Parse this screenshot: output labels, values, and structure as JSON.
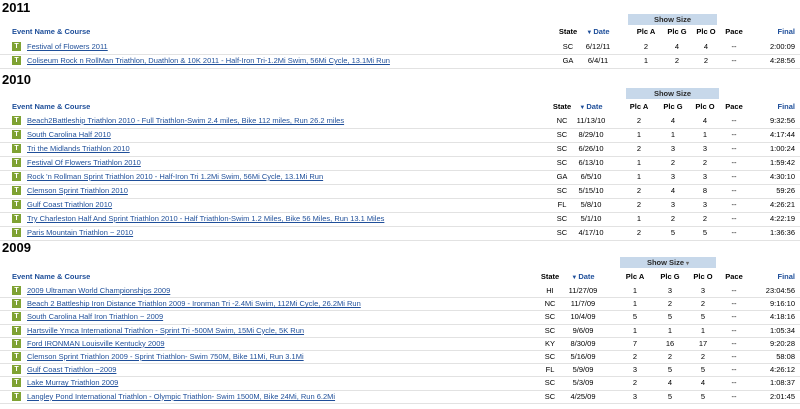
{
  "columns": {
    "event": "Event Name & Course",
    "state": "State",
    "date": "Date",
    "date_sort": "▼",
    "plc_a": "Plc A",
    "plc_g": "Plc G",
    "plc_o": "Plc O",
    "pace": "Pace",
    "final": "Final",
    "show_size": "Show Size",
    "show_size_caret": "▾"
  },
  "type_icon": "T",
  "sections": [
    {
      "year": "2011",
      "rows": [
        {
          "event": "Festival of Flowers 2011",
          "state": "SC",
          "date": "6/12/11",
          "a": "2",
          "g": "4",
          "o": "4",
          "pace": "--",
          "final": "2:00:09"
        },
        {
          "event": "Coliseum Rock n RollMan Triathlon, Duathlon & 10K 2011 - Half-Iron Tri-1.2Mi Swim, 56Mi Cycle, 13.1Mi Run",
          "state": "GA",
          "date": "6/4/11",
          "a": "1",
          "g": "2",
          "o": "2",
          "pace": "--",
          "final": "4:28:56"
        }
      ]
    },
    {
      "year": "2010",
      "rows": [
        {
          "event": "Beach2Battleship Triathlon 2010 - Full Triathlon-Swim 2.4 miles, Bike 112 miles, Run 26.2 miles",
          "state": "NC",
          "date": "11/13/10",
          "a": "2",
          "g": "4",
          "o": "4",
          "pace": "--",
          "final": "9:32:56"
        },
        {
          "event": "South Carolina Half 2010",
          "state": "SC",
          "date": "8/29/10",
          "a": "1",
          "g": "1",
          "o": "1",
          "pace": "--",
          "final": "4:17:44"
        },
        {
          "event": "Tri the Midlands Triathlon 2010",
          "state": "SC",
          "date": "6/26/10",
          "a": "2",
          "g": "3",
          "o": "3",
          "pace": "--",
          "final": "1:00:24"
        },
        {
          "event": "Festival Of Flowers Triathlon 2010",
          "state": "SC",
          "date": "6/13/10",
          "a": "1",
          "g": "2",
          "o": "2",
          "pace": "--",
          "final": "1:59:42"
        },
        {
          "event": "Rock 'n Rollman Sprint Triathlon 2010 - Half-Iron Tri 1.2Mi Swim, 56Mi Cycle, 13.1Mi Run",
          "state": "GA",
          "date": "6/5/10",
          "a": "1",
          "g": "3",
          "o": "3",
          "pace": "--",
          "final": "4:30:10"
        },
        {
          "event": "Clemson Sprint Triathlon 2010",
          "state": "SC",
          "date": "5/15/10",
          "a": "2",
          "g": "4",
          "o": "8",
          "pace": "--",
          "final": "59:26"
        },
        {
          "event": "Gulf Coast Triathlon 2010",
          "state": "FL",
          "date": "5/8/10",
          "a": "2",
          "g": "3",
          "o": "3",
          "pace": "--",
          "final": "4:26:21"
        },
        {
          "event": "Try Charleston Half And Sprint Triathlon 2010 - Half Triathlon-Swim 1.2 Miles, Bike 56 Miles, Run 13.1 Miles",
          "state": "SC",
          "date": "5/1/10",
          "a": "1",
          "g": "2",
          "o": "2",
          "pace": "--",
          "final": "4:22:19"
        },
        {
          "event": "Paris Mountain Triathlon ~ 2010",
          "state": "SC",
          "date": "4/17/10",
          "a": "2",
          "g": "5",
          "o": "5",
          "pace": "--",
          "final": "1:36:36"
        }
      ]
    },
    {
      "year": "2009",
      "rows": [
        {
          "event": "2009 Ultraman World Championships 2009",
          "state": "HI",
          "date": "11/27/09",
          "a": "1",
          "g": "3",
          "o": "3",
          "pace": "--",
          "final": "23:04:56"
        },
        {
          "event": "Beach 2 Battleship Iron Distance Triathlon 2009 - Ironman Tri -2.4Mi Swim, 112Mi Cycle, 26.2Mi Run",
          "state": "NC",
          "date": "11/7/09",
          "a": "1",
          "g": "2",
          "o": "2",
          "pace": "--",
          "final": "9:16:10"
        },
        {
          "event": "South Carolina Half Iron Triathlon ~ 2009",
          "state": "SC",
          "date": "10/4/09",
          "a": "5",
          "g": "5",
          "o": "5",
          "pace": "--",
          "final": "4:18:16"
        },
        {
          "event": "Hartsville Ymca International Triathlon - Sprint Tri -500M Swim, 15Mi Cycle, 5K Run",
          "state": "SC",
          "date": "9/6/09",
          "a": "1",
          "g": "1",
          "o": "1",
          "pace": "--",
          "final": "1:05:34"
        },
        {
          "event": "Ford IRONMAN Louisville Kentucky 2009",
          "state": "KY",
          "date": "8/30/09",
          "a": "7",
          "g": "16",
          "o": "17",
          "pace": "--",
          "final": "9:20:28"
        },
        {
          "event": "Clemson Sprint Triathlon 2009 - Sprint Triathlon- Swim 750M, Bike 11Mi, Run 3.1Mi",
          "state": "SC",
          "date": "5/16/09",
          "a": "2",
          "g": "2",
          "o": "2",
          "pace": "--",
          "final": "58:08"
        },
        {
          "event": "Gulf Coast Triathlon ~2009",
          "state": "FL",
          "date": "5/9/09",
          "a": "3",
          "g": "5",
          "o": "5",
          "pace": "--",
          "final": "4:26:12"
        },
        {
          "event": "Lake Murray Triathlon 2009",
          "state": "SC",
          "date": "5/3/09",
          "a": "2",
          "g": "4",
          "o": "4",
          "pace": "--",
          "final": "1:08:37"
        },
        {
          "event": "Langley Pond International Triathlon - Olympic Triathlon- Swim 1500M, Bike 24Mi, Run 6.2Mi",
          "state": "SC",
          "date": "4/25/09",
          "a": "3",
          "g": "5",
          "o": "5",
          "pace": "--",
          "final": "2:01:45"
        }
      ]
    }
  ]
}
